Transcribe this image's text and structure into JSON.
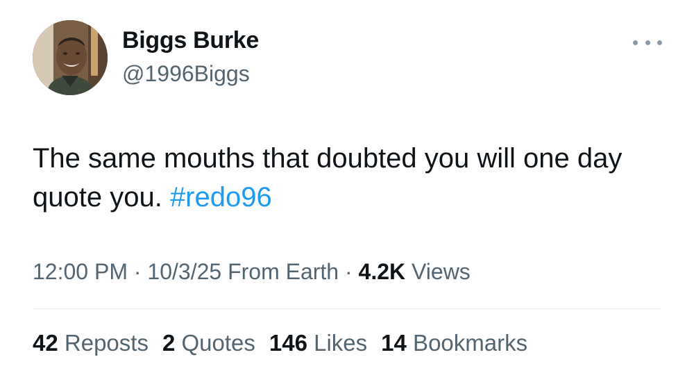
{
  "author": {
    "display_name": "Biggs Burke",
    "handle": "@1996Biggs",
    "avatar_icon": "profile-photo"
  },
  "more_icon": "ellipsis-icon",
  "tweet": {
    "text_line1": "The same mouths that doubted you will one day",
    "text_line2": "quote you. ",
    "hashtag": "#redo96"
  },
  "meta": {
    "time": "12:00 PM",
    "sep1": " · ",
    "date": "10/3/25",
    "location": " From Earth",
    "sep2": " · ",
    "views_count": "4.2K",
    "views_label": " Views"
  },
  "stats": {
    "reposts_count": "42",
    "reposts_label": " Reposts",
    "quotes_count": "2",
    "quotes_label": " Quotes",
    "likes_count": "146",
    "likes_label": " Likes",
    "bookmarks_count": "14",
    "bookmarks_label": " Bookmarks"
  },
  "colors": {
    "text": "#0f1419",
    "secondary": "#536471",
    "link": "#1d9bf0",
    "divider": "#e6ecf0"
  }
}
